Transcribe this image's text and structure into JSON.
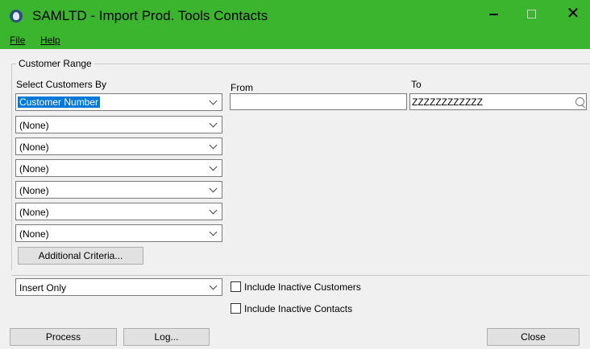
{
  "window": {
    "title": "SAMLTD - Import Prod. Tools Contacts",
    "close_glyph": "✕",
    "accent_color": "#3bb52e"
  },
  "menu": {
    "file": "File",
    "help": "Help"
  },
  "group": {
    "label": "Customer Range"
  },
  "criteria": {
    "select_by_label": "Select Customers By",
    "from_label": "From",
    "to_label": "To",
    "rows": [
      "Customer Number",
      "(None)",
      "(None)",
      "(None)",
      "(None)",
      "(None)",
      "(None)"
    ],
    "from_value": "",
    "to_value": "ZZZZZZZZZZZZ",
    "additional_button": "Additional Criteria..."
  },
  "options": {
    "mode_value": "Insert Only",
    "include_inactive_customers": "Include Inactive Customers",
    "include_inactive_contacts": "Include Inactive Contacts",
    "inactive_customers_checked": false,
    "inactive_contacts_checked": false
  },
  "buttons": {
    "process": "Process",
    "log": "Log...",
    "close": "Close"
  },
  "icons": [
    "app-icon",
    "minimize-icon",
    "maximize-icon",
    "close-icon",
    "chevron-down-icon",
    "search-icon"
  ]
}
